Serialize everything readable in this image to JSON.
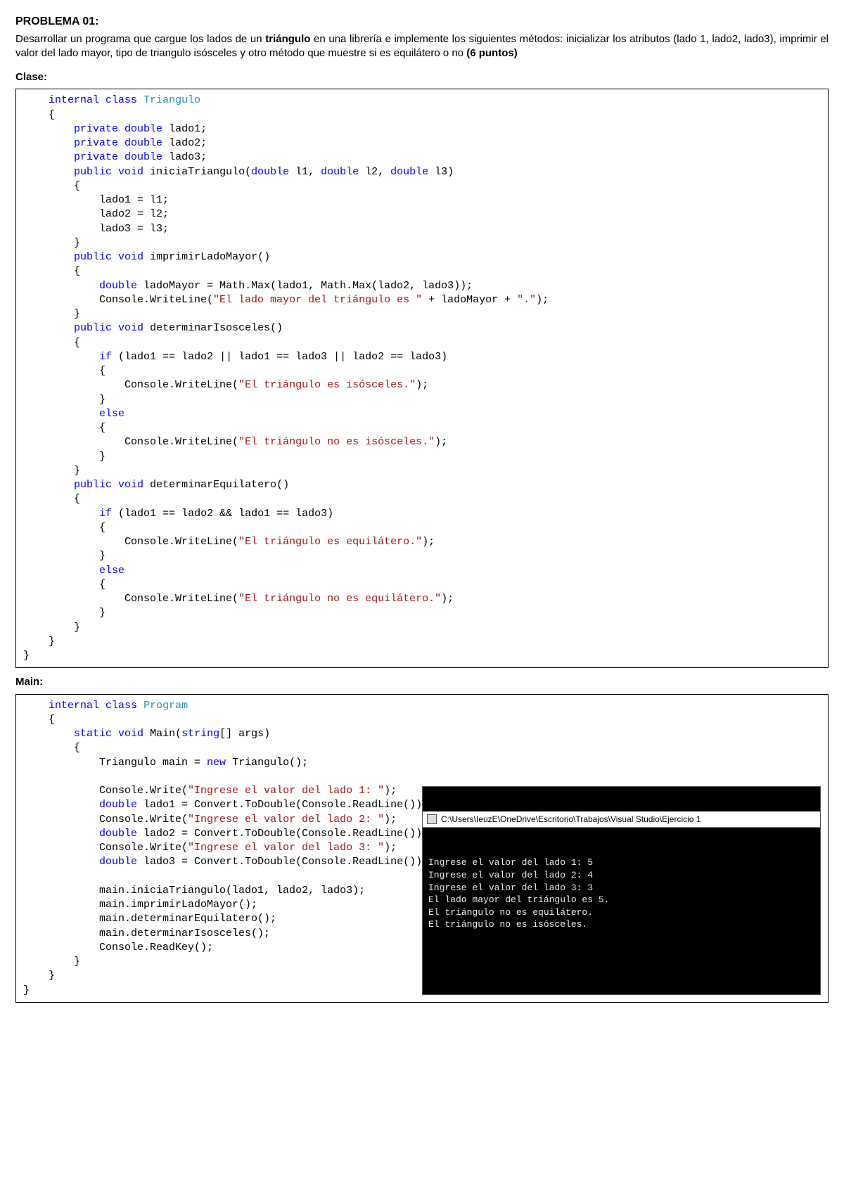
{
  "problem": {
    "title": "PROBLEMA 01:",
    "desc_html": "Desarrollar un programa que cargue los lados de un <b>triángulo</b> en una librería e implemente los siguientes métodos: inicializar los atributos (lado 1, lado2, lado3), imprimir el valor del lado mayor, tipo de triangulo isósceles y otro método que muestre si es equilátero o no <b>(6 puntos)</b>"
  },
  "labels": {
    "clase": "Clase:",
    "main": "Main:"
  },
  "code_clase": {
    "l1": "internal",
    "l1b": "class",
    "l1c": "Triangulo",
    "priv": "private",
    "dbl": "double",
    "f1": "lado1",
    "f2": "lado2",
    "f3": "lado3",
    "pub": "public",
    "vd": "void",
    "m_init": "iniciaTriangulo",
    "p_l1": "l1",
    "p_l2": "l2",
    "p_l3": "l3",
    "a1": "lado1 = l1;",
    "a2": "lado2 = l2;",
    "a3": "lado3 = l3;",
    "m_mayor": "imprimirLadoMayor",
    "mayor_expr": "ladoMayor = Math.Max(lado1, Math.Max(lado2, lado3));",
    "mayor_cw": "Console.WriteLine(",
    "mayor_str": "\"El lado mayor del triángulo es \"",
    "mayor_tail": " + ladoMayor + ",
    "mayor_dot": "\".\"",
    "m_iso": "determinarIsosceles",
    "if": "if",
    "else": "else",
    "iso_cond": "(lado1 == lado2 || lado1 == lado3 || lado2 == lado3)",
    "iso_yes": "\"El triángulo es isósceles.\"",
    "iso_no": "\"El triángulo no es isósceles.\"",
    "m_equi": "determinarEquilatero",
    "equi_cond": "(lado1 == lado2 && lado1 == lado3)",
    "equi_yes": "\"El triángulo es equilátero.\"",
    "equi_no": "\"El triángulo no es equilátero.\""
  },
  "code_main": {
    "cls": "Program",
    "static": "static",
    "vd": "void",
    "main": "Main",
    "string": "string",
    "args": "[] args",
    "new": "new",
    "inst": "Triangulo main = ",
    "inst2": " Triangulo();",
    "cw": "Console.Write(",
    "prompt1": "\"Ingrese el valor del lado 1: \"",
    "prompt2": "\"Ingrese el valor del lado 2: \"",
    "prompt3": "\"Ingrese el valor del lado 3: \"",
    "read": " = Convert.ToDouble(Console.ReadLine());",
    "v1": "lado1",
    "v2": "lado2",
    "v3": "lado3",
    "call1": "main.iniciaTriangulo(lado1, lado2, lado3);",
    "call2": "main.imprimirLadoMayor();",
    "call3": "main.determinarEquilatero();",
    "call4": "main.determinarIsosceles();",
    "call5": "Console.ReadKey();"
  },
  "console": {
    "title": "C:\\Users\\IeuzE\\OneDrive\\Escritorio\\Trabajos\\Visual Studio\\Ejercicio 1",
    "lines": [
      "Ingrese el valor del lado 1: 5",
      "Ingrese el valor del lado 2: 4",
      "Ingrese el valor del lado 3: 3",
      "El lado mayor del triángulo es 5.",
      "El triángulo no es equilátero.",
      "El triángulo no es isósceles."
    ]
  }
}
